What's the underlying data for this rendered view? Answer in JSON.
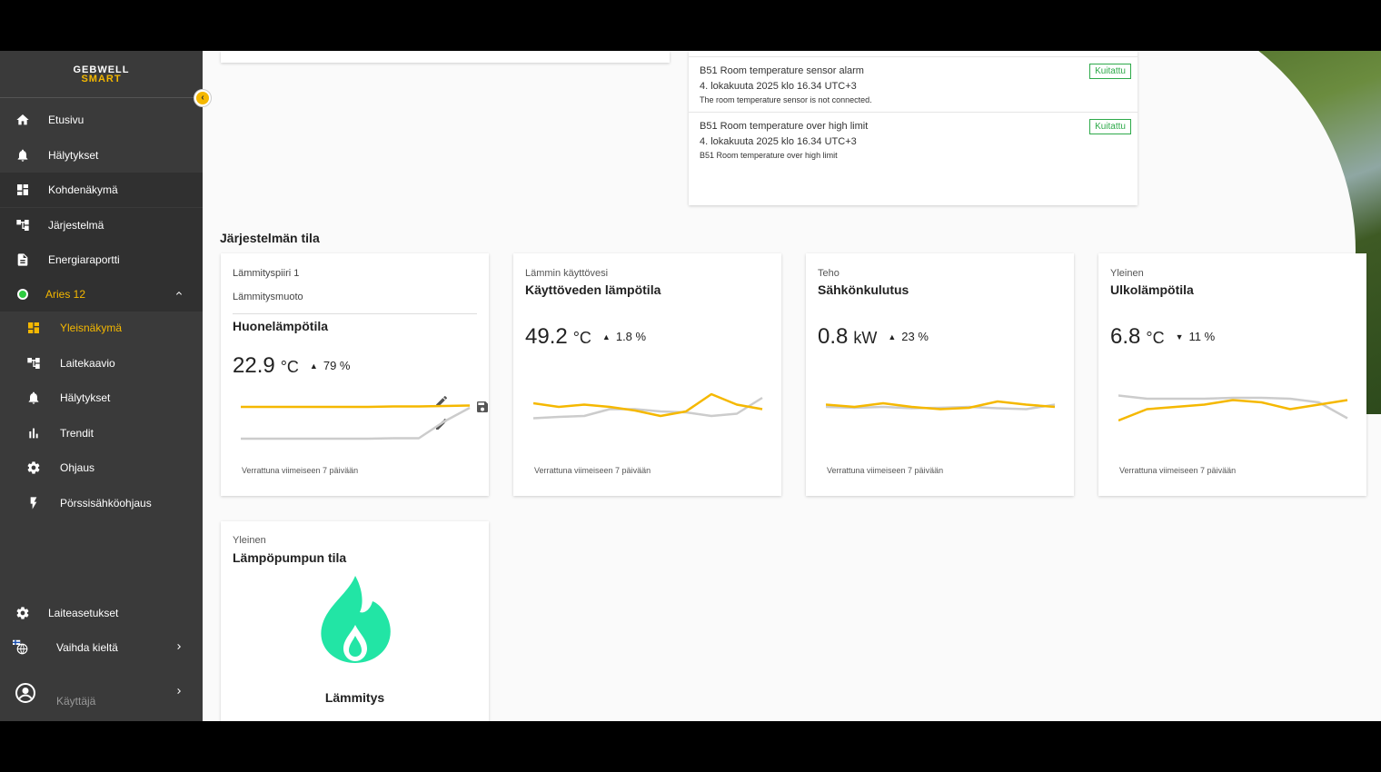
{
  "brand": {
    "line1": "GEBWELL",
    "line2": "SMART"
  },
  "colors": {
    "accent": "#f5b800",
    "flame": "#22e5a5",
    "ack": "#2eaa4a",
    "sidebar": "#3a3a3a"
  },
  "sidebar": {
    "items": [
      {
        "label": "Etusivu",
        "icon": "home-icon"
      },
      {
        "label": "Hälytykset",
        "icon": "bell-icon"
      },
      {
        "label": "Kohdenäkymä",
        "icon": "dashboard-icon"
      },
      {
        "label": "Järjestelmä",
        "icon": "hierarchy-icon"
      },
      {
        "label": "Energiaraportti",
        "icon": "report-icon"
      }
    ],
    "device": {
      "label": "Aries 12",
      "icon": "status-dot-icon"
    },
    "sub_items": [
      {
        "label": "Yleisnäkymä",
        "icon": "dashboard-icon"
      },
      {
        "label": "Laitekaavio",
        "icon": "hierarchy-icon"
      },
      {
        "label": "Hälytykset",
        "icon": "bell-icon"
      },
      {
        "label": "Trendit",
        "icon": "bar-chart-icon"
      },
      {
        "label": "Ohjaus",
        "icon": "gear-icon"
      },
      {
        "label": "Pörssisähköohjaus",
        "icon": "lightning-icon"
      }
    ],
    "bottom": {
      "settings": "Laiteasetukset",
      "language": "Vaihda kieltä",
      "user": "Käyttäjä"
    }
  },
  "alarms": [
    {
      "title": "B51 Room temperature sensor alarm",
      "date": "4. lokakuuta 2025 klo 16.34 UTC+3",
      "desc": "The room temperature sensor is not connected.",
      "ack": "Kuitattu"
    },
    {
      "title": "B51 Room temperature over high limit",
      "date": "4. lokakuuta 2025 klo 16.34 UTC+3",
      "desc": "B51 Room temperature over high limit",
      "ack": "Kuitattu"
    }
  ],
  "section_title": "Järjestelmän tila",
  "heating_card": {
    "field1": "Lämmityspiiri 1",
    "field2": "Lämmitysmuoto",
    "title": "Huonelämpötila",
    "value": "22.9",
    "unit": "°C",
    "arrow": "▲",
    "percent": "79 %",
    "footer": "Verrattuna viimeiseen 7 päivään",
    "series_current": [
      0.82,
      0.82,
      0.82,
      0.82,
      0.82,
      0.82,
      0.83,
      0.83,
      0.84,
      0.85
    ],
    "series_previous": [
      0.12,
      0.12,
      0.12,
      0.12,
      0.12,
      0.12,
      0.13,
      0.13,
      0.5,
      0.8
    ]
  },
  "metric_cards": [
    {
      "category": "Lämmin käyttövesi",
      "title": "Käyttöveden lämpötila",
      "value": "49.2",
      "unit": "°C",
      "arrow": "▲",
      "percent": "1.8 %",
      "footer": "Verrattuna viimeiseen 7 päivään",
      "series_current": [
        0.58,
        0.5,
        0.55,
        0.5,
        0.42,
        0.3,
        0.4,
        0.78,
        0.55,
        0.45
      ],
      "series_previous": [
        0.25,
        0.28,
        0.3,
        0.45,
        0.45,
        0.4,
        0.38,
        0.3,
        0.35,
        0.7
      ]
    },
    {
      "category": "Teho",
      "title": "Sähkönkulutus",
      "value": "0.8",
      "unit": "kW",
      "arrow": "▲",
      "percent": "23 %",
      "footer": "Verrattuna viimeiseen 7 päivään",
      "series_current": [
        0.55,
        0.5,
        0.58,
        0.5,
        0.45,
        0.48,
        0.62,
        0.55,
        0.5
      ],
      "series_previous": [
        0.5,
        0.48,
        0.5,
        0.47,
        0.48,
        0.5,
        0.47,
        0.45,
        0.55
      ]
    },
    {
      "category": "Yleinen",
      "title": "Ulkolämpötila",
      "value": "6.8",
      "unit": "°C",
      "arrow": "▼",
      "percent": "11 %",
      "footer": "Verrattuna viimeiseen 7 päivään",
      "series_current": [
        0.2,
        0.45,
        0.5,
        0.55,
        0.65,
        0.6,
        0.45,
        0.55,
        0.65
      ],
      "series_previous": [
        0.75,
        0.68,
        0.68,
        0.68,
        0.7,
        0.7,
        0.68,
        0.6,
        0.25
      ]
    }
  ],
  "pump_card": {
    "category": "Yleinen",
    "title": "Lämpöpumpun tila",
    "state": "Lämmitys",
    "icon": "flame-icon"
  }
}
